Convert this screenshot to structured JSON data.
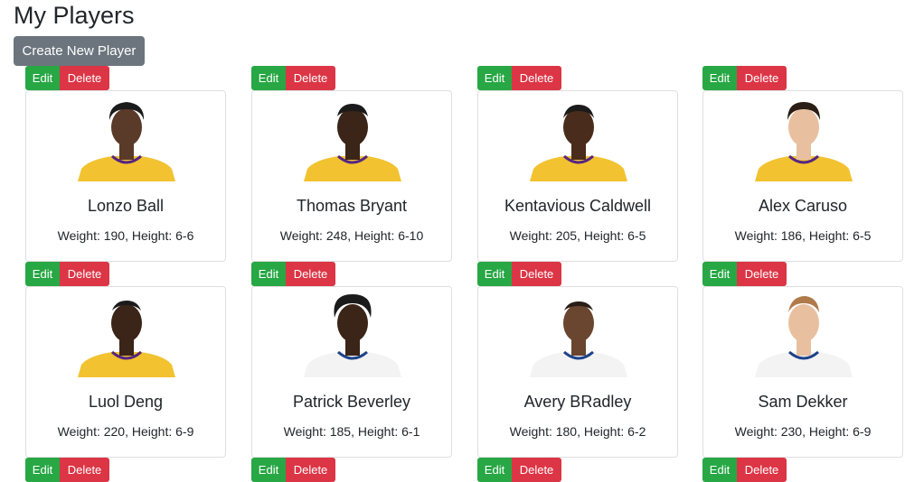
{
  "page": {
    "title": "My Players",
    "create_label": "Create New Player",
    "edit_label": "Edit",
    "delete_label": "Delete"
  },
  "colors": {
    "edit": "#28a745",
    "delete": "#dc3545",
    "create": "#6c757d",
    "skin_dark": "#5a3a28",
    "skin_light": "#e8c0a0",
    "jersey_lakers": "#f2c230",
    "jersey_clippers": "#f3f3f3"
  },
  "players": [
    {
      "name": "Lonzo Ball",
      "stats": "Weight: 190, Height: 6-6"
    },
    {
      "name": "Thomas Bryant",
      "stats": "Weight: 248, Height: 6-10"
    },
    {
      "name": "Kentavious Caldwell",
      "stats": "Weight: 205, Height: 6-5"
    },
    {
      "name": "Alex Caruso",
      "stats": "Weight: 186, Height: 6-5"
    },
    {
      "name": "Luol Deng",
      "stats": "Weight: 220, Height: 6-9"
    },
    {
      "name": "Patrick Beverley",
      "stats": "Weight: 185, Height: 6-1"
    },
    {
      "name": "Avery BRadley",
      "stats": "Weight: 180, Height: 6-2"
    },
    {
      "name": "Sam Dekker",
      "stats": "Weight: 230, Height: 6-9"
    }
  ]
}
